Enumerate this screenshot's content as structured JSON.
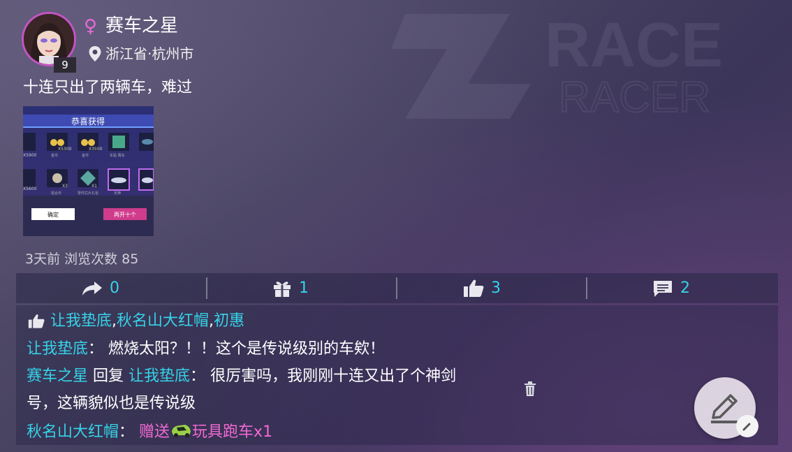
{
  "colors": {
    "accent_cyan": "#35d3e8",
    "accent_pink": "#f26ad2",
    "gender_icon": "#e86ad6"
  },
  "watermark": {
    "line1": "RACE",
    "line2": "RACER"
  },
  "profile": {
    "username": "赛车之星",
    "gender_icon": "female-icon",
    "level": "9",
    "location": "浙江省·杭州市"
  },
  "post": {
    "text": "十连只出了两辆车，难过",
    "image": {
      "title": "恭喜获得",
      "confirm_label": "确定",
      "again_label": "再开十个",
      "row1_labels": [
        "X5900",
        "X5300",
        "X3500"
      ],
      "row1_captions": [
        "金币",
        "金币",
        "车贴 赛车"
      ],
      "row2_labels": [
        "X5600",
        "X3",
        "X1"
      ],
      "row2_captions": [
        "铝合币",
        "零件芯片礼包",
        "无神"
      ]
    },
    "meta": "3天前  浏览次数 85"
  },
  "actions": [
    {
      "icon": "share-icon",
      "count": "0"
    },
    {
      "icon": "gift-icon",
      "count": "1"
    },
    {
      "icon": "thumbs-up-icon",
      "count": "3"
    },
    {
      "icon": "comment-icon",
      "count": "2"
    }
  ],
  "likes": {
    "users": [
      "让我垫底",
      "秋名山大红帽",
      "初惠"
    ],
    "separator": ","
  },
  "comments": [
    {
      "author": "让我垫底",
      "colon": "：",
      "text": "燃烧太阳？！！这个是传说级别的车欸！"
    },
    {
      "author": "赛车之星",
      "reply_word": "回复",
      "reply_to": "让我垫底",
      "colon": "：",
      "text_line1": "很厉害吗，我刚刚十连又出了个神剑",
      "text_line2": "号，这辆貌似也是传说级"
    },
    {
      "author": "秋名山大红帽",
      "colon": "：",
      "gift_text": "赠送",
      "gift_item": "玩具跑车x1"
    }
  ]
}
